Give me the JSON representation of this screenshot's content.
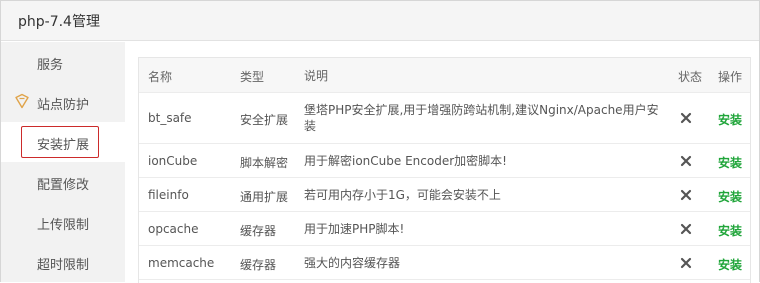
{
  "window": {
    "title": "php-7.4管理"
  },
  "sidebar": {
    "items": [
      {
        "label": "服务"
      },
      {
        "label": "站点防护"
      },
      {
        "label": "安装扩展"
      },
      {
        "label": "配置修改"
      },
      {
        "label": "上传限制"
      },
      {
        "label": "超时限制"
      }
    ]
  },
  "table": {
    "headers": {
      "name": "名称",
      "type": "类型",
      "desc": "说明",
      "state": "状态",
      "op": "操作"
    },
    "rows": [
      {
        "name": "bt_safe",
        "type": "安全扩展",
        "desc": "堡塔PHP安全扩展,用于增强防跨站机制,建议Nginx/Apache用户安装",
        "state_icon": "x-icon",
        "op": "安装"
      },
      {
        "name": "ionCube",
        "type": "脚本解密",
        "desc": "用于解密ionCube Encoder加密脚本!",
        "state_icon": "x-icon",
        "op": "安装"
      },
      {
        "name": "fileinfo",
        "type": "通用扩展",
        "desc": "若可用内存小于1G，可能会安装不上",
        "state_icon": "x-icon",
        "op": "安装"
      },
      {
        "name": "opcache",
        "type": "缓存器",
        "desc": "用于加速PHP脚本!",
        "state_icon": "x-icon",
        "op": "安装"
      },
      {
        "name": "memcache",
        "type": "缓存器",
        "desc": "强大的内容缓存器",
        "state_icon": "x-icon",
        "op": "安装"
      }
    ]
  },
  "colors": {
    "accent_green": "#20a53a",
    "active_box_red": "#cc2b2b",
    "shield_orange": "#e0a44a"
  }
}
